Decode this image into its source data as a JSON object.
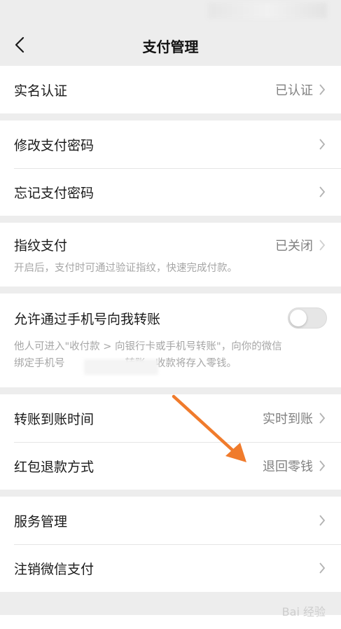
{
  "header": {
    "title": "支付管理",
    "back_icon": "chevron-left-icon"
  },
  "groups": [
    {
      "rows": [
        {
          "label": "实名认证",
          "value": "已认证"
        }
      ]
    },
    {
      "rows": [
        {
          "label": "修改支付密码",
          "value": ""
        },
        {
          "label": "忘记支付密码",
          "value": ""
        }
      ]
    },
    {
      "rows": [
        {
          "label": "指纹支付",
          "value": "已关闭",
          "desc": "开启后，支付时可通过验证指纹，快速完成付款。"
        }
      ]
    },
    {
      "rows": [
        {
          "label": "允许通过手机号向我转账",
          "toggle": false,
          "desc_line1": "他人可进入\"收付款 > 向银行卡或手机号转账\"，向你的微信",
          "desc_line2_before": "绑定手机号",
          "desc_line2_after": "转账，收款将存入零钱。"
        }
      ]
    },
    {
      "rows": [
        {
          "label": "转账到账时间",
          "value": "实时到账"
        },
        {
          "label": "红包退款方式",
          "value": "退回零钱"
        }
      ]
    },
    {
      "rows": [
        {
          "label": "服务管理",
          "value": ""
        },
        {
          "label": "注销微信支付",
          "value": ""
        }
      ]
    }
  ],
  "annotation": {
    "color": "#f07b2c"
  },
  "watermark": "Bai 经验"
}
